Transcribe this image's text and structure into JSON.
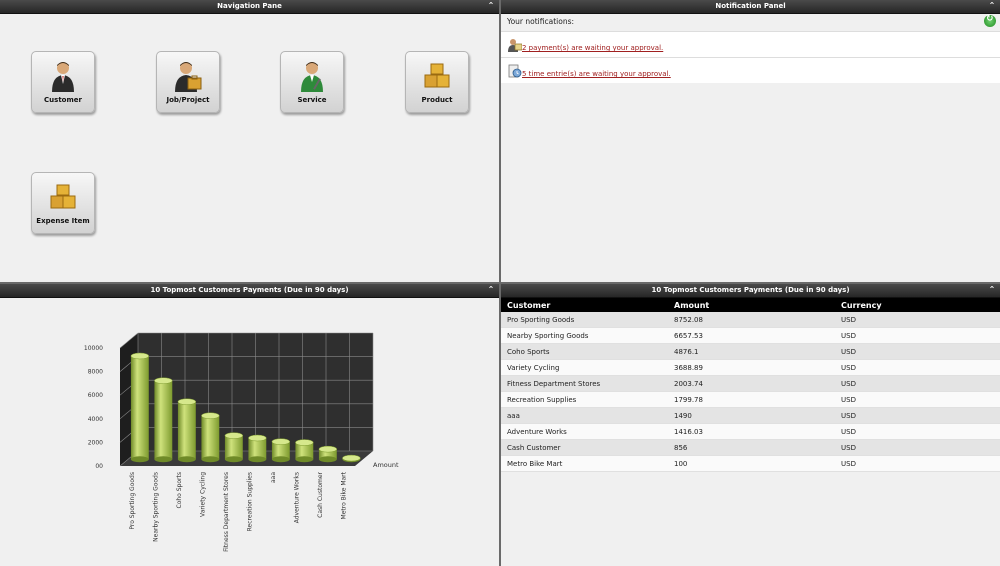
{
  "nav": {
    "title": "Navigation Pane",
    "buttons": [
      {
        "label": "Customer"
      },
      {
        "label": "Job/Project"
      },
      {
        "label": "Service"
      },
      {
        "label": "Product"
      },
      {
        "label": "Expense Item"
      }
    ]
  },
  "notifications": {
    "title": "Notification Panel",
    "heading": "Your notifications:",
    "items": [
      {
        "text": " 2 payment(s) are waiting your approval."
      },
      {
        "text": " 5 time entrie(s) are waiting your approval."
      }
    ]
  },
  "chart_panel": {
    "title": "10 Topmost Customers Payments (Due in 90 days)"
  },
  "chart_data": {
    "type": "bar",
    "categories": [
      "Pro Sporting Goods",
      "Nearby Sporting Goods",
      "Coho Sports",
      "Variety Cycling",
      "Fitness Department Stores",
      "Recreation Supplies",
      "aaa",
      "Adventure Works",
      "Cash Customer",
      "Metro Bike Mart"
    ],
    "values": [
      8752.08,
      6657.53,
      4876.1,
      3688.89,
      2003.74,
      1799.78,
      1490,
      1416.03,
      856,
      100
    ],
    "ylim": [
      0,
      10000
    ],
    "yticks": [
      "00",
      "2000",
      "4000",
      "6000",
      "8000",
      "10000"
    ],
    "series_label": "Amount",
    "bar_color": "#a8c44e",
    "wall_color": "#2f2f2f"
  },
  "table_panel": {
    "title": "10 Topmost Customers Payments (Due in 90 days)",
    "headers": [
      "Customer",
      "Amount",
      "Currency"
    ],
    "rows": [
      [
        "Pro Sporting Goods",
        "8752.08",
        "USD"
      ],
      [
        "Nearby Sporting Goods",
        "6657.53",
        "USD"
      ],
      [
        "Coho Sports",
        "4876.1",
        "USD"
      ],
      [
        "Variety Cycling",
        "3688.89",
        "USD"
      ],
      [
        "Fitness Department Stores",
        "2003.74",
        "USD"
      ],
      [
        "Recreation Supplies",
        "1799.78",
        "USD"
      ],
      [
        "aaa",
        "1490",
        "USD"
      ],
      [
        "Adventure Works",
        "1416.03",
        "USD"
      ],
      [
        "Cash Customer",
        "856",
        "USD"
      ],
      [
        "Metro Bike Mart",
        "100",
        "USD"
      ]
    ]
  }
}
